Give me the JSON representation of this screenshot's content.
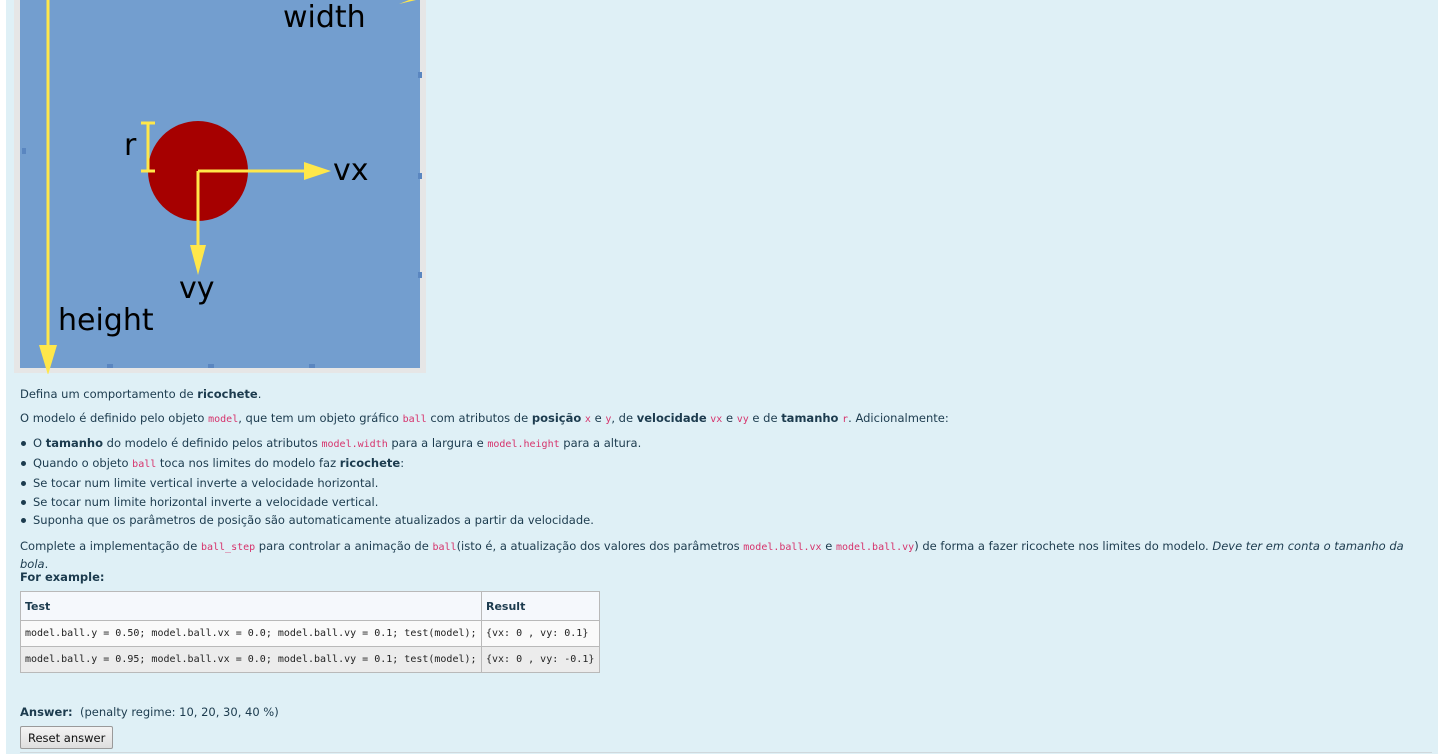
{
  "figure": {
    "labels": {
      "width": "width",
      "height": "height",
      "r": "r",
      "vx": "vx",
      "vy": "vy"
    },
    "colors": {
      "board": "#739ecf",
      "ball": "#a60000",
      "arrow": "#ffe74a",
      "frame": "#e6e6e6"
    }
  },
  "intro": {
    "t1": "Defina um comportamento de ",
    "b1": "ricochete",
    "t2": "."
  },
  "model": {
    "t1": "O modelo é definido pelo objeto ",
    "c1": "model",
    "t2": ", que tem um objeto gráfico ",
    "c2": "ball",
    "t3": " com atributos de ",
    "b1": "posição",
    "t4": " ",
    "c3": "x",
    "t5": " e ",
    "c4": "y",
    "t6": ", de ",
    "b2": "velocidade",
    "t7": " ",
    "c5": "vx",
    "t8": " e ",
    "c6": "vy",
    "t9": " e de ",
    "b3": "tamanho",
    "t10": " ",
    "c7": "r",
    "t11": ". Adicionalmente:"
  },
  "bullets": {
    "b1": {
      "t1": "O ",
      "b": "tamanho",
      "t2": " do modelo é definido pelos atributos ",
      "c1": "model.width",
      "t3": " para a largura e ",
      "c2": "model.height",
      "t4": " para a altura."
    },
    "b2": {
      "t1": "Quando o objeto ",
      "c1": "ball",
      "t2": " toca nos limites do modelo faz ",
      "b": "ricochete",
      "t3": ":"
    },
    "b3": "Se tocar num limite vertical inverte a velocidade horizontal.",
    "b4": "Se tocar num limite horizontal inverte a velocidade vertical.",
    "b5": "Suponha que os parâmetros de posição são automaticamente atualizados a partir da velocidade."
  },
  "task": {
    "t1": "Complete a implementação de ",
    "c1": "ball_step",
    "t2": " para controlar a animação de ",
    "c2": "ball",
    "t3": "(isto é, a atualização dos valores dos parâmetros ",
    "c3": "model.ball.vx",
    "t4": " e ",
    "c4": "model.ball.vy",
    "t5": ") de forma a fazer ricochete nos limites do modelo. ",
    "i1": "Deve ter em conta o tamanho da bola",
    "t6": "."
  },
  "example": {
    "heading": "For example:",
    "headers": [
      "Test",
      "Result"
    ],
    "rows": [
      [
        "model.ball.y = 0.50; model.ball.vx = 0.0; model.ball.vy = 0.1; test(model);",
        "{vx: 0 , vy: 0.1}"
      ],
      [
        "model.ball.y = 0.95; model.ball.vx = 0.0; model.ball.vy = 0.1; test(model);",
        "{vx: 0 , vy: -0.1}"
      ]
    ]
  },
  "answer": {
    "label": "Answer:",
    "penalty": "(penalty regime: 10, 20, 30, 40 %)",
    "reset_label": "Reset answer"
  }
}
